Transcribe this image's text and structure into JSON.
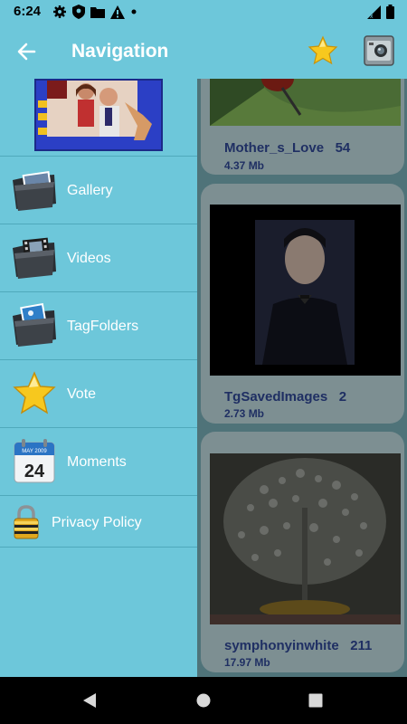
{
  "status_bar": {
    "time": "6:24",
    "icons": [
      "settings-icon",
      "shield-icon",
      "folder-icon",
      "warning-icon",
      "dot-icon"
    ],
    "right_icons": [
      "signal-icon",
      "battery-icon"
    ]
  },
  "app_bar": {
    "title": "Navigation",
    "back_icon": "arrow-left-icon",
    "actions": [
      "star-icon",
      "camera-icon"
    ]
  },
  "drawer": {
    "items": [
      {
        "label": "Gallery",
        "icon": "gallery-folder-icon"
      },
      {
        "label": "Videos",
        "icon": "video-folder-icon"
      },
      {
        "label": "TagFolders",
        "icon": "tag-folder-icon"
      },
      {
        "label": "Vote",
        "icon": "star-icon"
      },
      {
        "label": "Moments",
        "icon": "calendar-icon",
        "icon_text": "24",
        "icon_month": "MAY 2009"
      },
      {
        "label": "Privacy Policy",
        "icon": "lock-icon"
      }
    ]
  },
  "albums": [
    {
      "name": "Mother_s_Love",
      "count": "54",
      "size": "4.37 Mb"
    },
    {
      "name": "TgSavedImages",
      "count": "2",
      "size": "2.73 Mb"
    },
    {
      "name": "symphonyinwhite",
      "count": "211",
      "size": "17.97 Mb"
    }
  ],
  "colors": {
    "accent": "#6dc7da",
    "text_dark": "#1f2f63"
  }
}
